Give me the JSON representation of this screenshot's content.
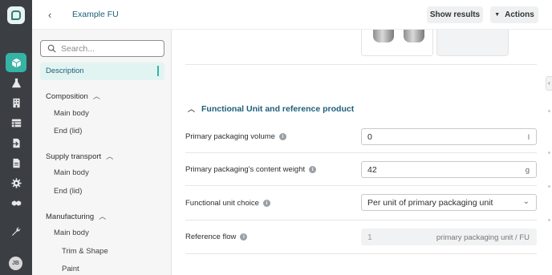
{
  "header": {
    "back_symbol": "‹",
    "title": "Example FU",
    "show_results_label": "Show results",
    "actions_label": "Actions",
    "actions_caret": "▼"
  },
  "rail": {
    "avatar_initials": "JB",
    "icons": [
      "box-icon",
      "flask-icon",
      "building-icon",
      "table-icon",
      "file-export-icon",
      "file-icon",
      "gear-icon",
      "handshake-icon",
      "wrench-icon"
    ],
    "accent_color": "#35b3a5"
  },
  "sidenav": {
    "search_placeholder": "Search...",
    "active_item": "Description",
    "groups": [
      {
        "label": "Composition",
        "items": [
          "Main body",
          "End (lid)"
        ]
      },
      {
        "label": "Supply transport",
        "items": [
          "Main body",
          "End (lid)"
        ]
      },
      {
        "label": "Manufacturing",
        "items": [
          "Main body"
        ],
        "subitems": [
          "Trim & Shape",
          "Paint"
        ]
      }
    ],
    "chevron_up": "︿"
  },
  "main": {
    "section_title": "Functional Unit and reference product",
    "section_chevron": "︿",
    "info_symbol": "i",
    "rows": [
      {
        "label": "Primary packaging volume",
        "value": "0",
        "unit": "l"
      },
      {
        "label": "Primary packaging's content weight",
        "value": "42",
        "unit": "g"
      },
      {
        "label": "Functional unit choice",
        "value": "Per unit of primary packaging unit",
        "arrow": "⌄"
      },
      {
        "label": "Reference flow",
        "value": "1",
        "unit": "primary packaging unit / FU"
      }
    ]
  },
  "edge_tab_symbol": "‹"
}
